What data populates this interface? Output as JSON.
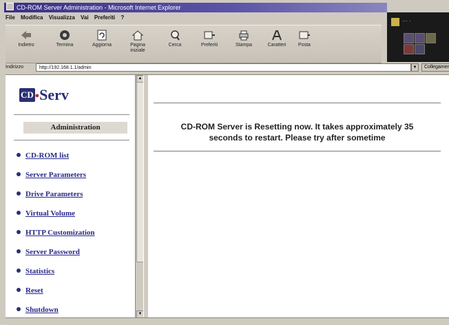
{
  "window": {
    "title": "CD-ROM Server Administration - Microsoft Internet Explorer"
  },
  "menu": [
    "File",
    "Modifica",
    "Visualizza",
    "Vai",
    "Preferiti",
    "?"
  ],
  "toolbar": [
    {
      "label": "Indietro",
      "icon": "back-arrow-icon"
    },
    {
      "label": "Termina",
      "icon": "stop-icon"
    },
    {
      "label": "Aggiorna",
      "icon": "refresh-icon"
    },
    {
      "label": "Pagina iniziale",
      "icon": "home-icon"
    },
    {
      "label": "Cerca",
      "icon": "search-icon"
    },
    {
      "label": "Preferiti",
      "icon": "favorites-icon"
    },
    {
      "label": "Stampa",
      "icon": "print-icon"
    },
    {
      "label": "Caratteri",
      "icon": "font-icon"
    },
    {
      "label": "Posta",
      "icon": "mail-icon"
    }
  ],
  "address": {
    "label": "Indirizzo",
    "value": "http://192.168.1.1/admin",
    "go_label": "Collegamenti"
  },
  "sidebar": {
    "logo_cd": "CD",
    "logo_sep": "•",
    "logo_text": "Serv",
    "heading": "Administration",
    "items": [
      {
        "label": "CD-ROM list"
      },
      {
        "label": "Server Parameters"
      },
      {
        "label": "Drive Parameters"
      },
      {
        "label": "Virtual Volume"
      },
      {
        "label": "HTTP Customization"
      },
      {
        "label": "Server Password"
      },
      {
        "label": "Statistics"
      },
      {
        "label": "Reset"
      },
      {
        "label": "Shutdown"
      }
    ]
  },
  "main": {
    "message_line1": "CD-ROM Server is Resetting now. It takes approximately 35",
    "message_line2": "seconds to restart. Please try after sometime"
  }
}
